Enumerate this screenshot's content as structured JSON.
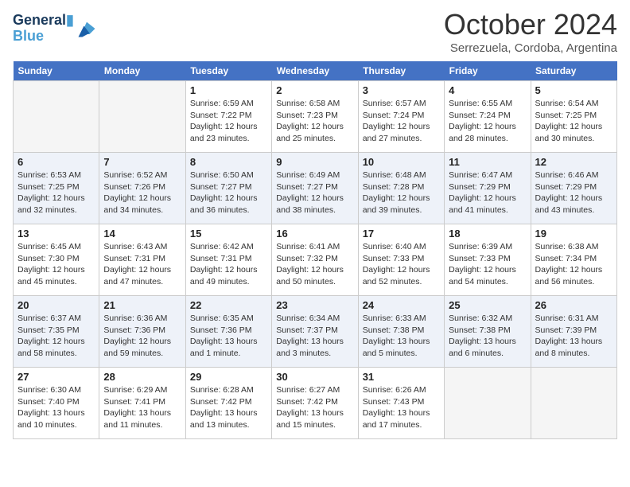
{
  "header": {
    "logo_line1": "General",
    "logo_line2": "Blue",
    "main_title": "October 2024",
    "subtitle": "Serrezuela, Cordoba, Argentina"
  },
  "days_of_week": [
    "Sunday",
    "Monday",
    "Tuesday",
    "Wednesday",
    "Thursday",
    "Friday",
    "Saturday"
  ],
  "weeks": [
    [
      {
        "day": "",
        "info": ""
      },
      {
        "day": "",
        "info": ""
      },
      {
        "day": "1",
        "info": "Sunrise: 6:59 AM\nSunset: 7:22 PM\nDaylight: 12 hours and 23 minutes."
      },
      {
        "day": "2",
        "info": "Sunrise: 6:58 AM\nSunset: 7:23 PM\nDaylight: 12 hours and 25 minutes."
      },
      {
        "day": "3",
        "info": "Sunrise: 6:57 AM\nSunset: 7:24 PM\nDaylight: 12 hours and 27 minutes."
      },
      {
        "day": "4",
        "info": "Sunrise: 6:55 AM\nSunset: 7:24 PM\nDaylight: 12 hours and 28 minutes."
      },
      {
        "day": "5",
        "info": "Sunrise: 6:54 AM\nSunset: 7:25 PM\nDaylight: 12 hours and 30 minutes."
      }
    ],
    [
      {
        "day": "6",
        "info": "Sunrise: 6:53 AM\nSunset: 7:25 PM\nDaylight: 12 hours and 32 minutes."
      },
      {
        "day": "7",
        "info": "Sunrise: 6:52 AM\nSunset: 7:26 PM\nDaylight: 12 hours and 34 minutes."
      },
      {
        "day": "8",
        "info": "Sunrise: 6:50 AM\nSunset: 7:27 PM\nDaylight: 12 hours and 36 minutes."
      },
      {
        "day": "9",
        "info": "Sunrise: 6:49 AM\nSunset: 7:27 PM\nDaylight: 12 hours and 38 minutes."
      },
      {
        "day": "10",
        "info": "Sunrise: 6:48 AM\nSunset: 7:28 PM\nDaylight: 12 hours and 39 minutes."
      },
      {
        "day": "11",
        "info": "Sunrise: 6:47 AM\nSunset: 7:29 PM\nDaylight: 12 hours and 41 minutes."
      },
      {
        "day": "12",
        "info": "Sunrise: 6:46 AM\nSunset: 7:29 PM\nDaylight: 12 hours and 43 minutes."
      }
    ],
    [
      {
        "day": "13",
        "info": "Sunrise: 6:45 AM\nSunset: 7:30 PM\nDaylight: 12 hours and 45 minutes."
      },
      {
        "day": "14",
        "info": "Sunrise: 6:43 AM\nSunset: 7:31 PM\nDaylight: 12 hours and 47 minutes."
      },
      {
        "day": "15",
        "info": "Sunrise: 6:42 AM\nSunset: 7:31 PM\nDaylight: 12 hours and 49 minutes."
      },
      {
        "day": "16",
        "info": "Sunrise: 6:41 AM\nSunset: 7:32 PM\nDaylight: 12 hours and 50 minutes."
      },
      {
        "day": "17",
        "info": "Sunrise: 6:40 AM\nSunset: 7:33 PM\nDaylight: 12 hours and 52 minutes."
      },
      {
        "day": "18",
        "info": "Sunrise: 6:39 AM\nSunset: 7:33 PM\nDaylight: 12 hours and 54 minutes."
      },
      {
        "day": "19",
        "info": "Sunrise: 6:38 AM\nSunset: 7:34 PM\nDaylight: 12 hours and 56 minutes."
      }
    ],
    [
      {
        "day": "20",
        "info": "Sunrise: 6:37 AM\nSunset: 7:35 PM\nDaylight: 12 hours and 58 minutes."
      },
      {
        "day": "21",
        "info": "Sunrise: 6:36 AM\nSunset: 7:36 PM\nDaylight: 12 hours and 59 minutes."
      },
      {
        "day": "22",
        "info": "Sunrise: 6:35 AM\nSunset: 7:36 PM\nDaylight: 13 hours and 1 minute."
      },
      {
        "day": "23",
        "info": "Sunrise: 6:34 AM\nSunset: 7:37 PM\nDaylight: 13 hours and 3 minutes."
      },
      {
        "day": "24",
        "info": "Sunrise: 6:33 AM\nSunset: 7:38 PM\nDaylight: 13 hours and 5 minutes."
      },
      {
        "day": "25",
        "info": "Sunrise: 6:32 AM\nSunset: 7:38 PM\nDaylight: 13 hours and 6 minutes."
      },
      {
        "day": "26",
        "info": "Sunrise: 6:31 AM\nSunset: 7:39 PM\nDaylight: 13 hours and 8 minutes."
      }
    ],
    [
      {
        "day": "27",
        "info": "Sunrise: 6:30 AM\nSunset: 7:40 PM\nDaylight: 13 hours and 10 minutes."
      },
      {
        "day": "28",
        "info": "Sunrise: 6:29 AM\nSunset: 7:41 PM\nDaylight: 13 hours and 11 minutes."
      },
      {
        "day": "29",
        "info": "Sunrise: 6:28 AM\nSunset: 7:42 PM\nDaylight: 13 hours and 13 minutes."
      },
      {
        "day": "30",
        "info": "Sunrise: 6:27 AM\nSunset: 7:42 PM\nDaylight: 13 hours and 15 minutes."
      },
      {
        "day": "31",
        "info": "Sunrise: 6:26 AM\nSunset: 7:43 PM\nDaylight: 13 hours and 17 minutes."
      },
      {
        "day": "",
        "info": ""
      },
      {
        "day": "",
        "info": ""
      }
    ]
  ]
}
